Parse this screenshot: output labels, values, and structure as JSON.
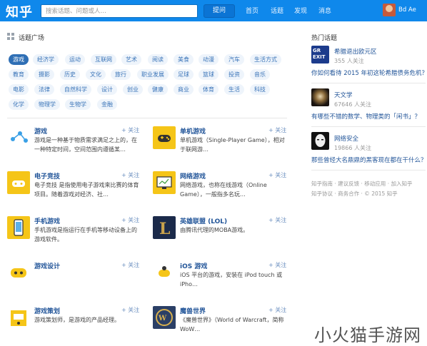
{
  "header": {
    "logo": "知乎",
    "search_placeholder": "搜索话题、问题或人…",
    "ask_label": "提问",
    "nav": [
      "首页",
      "话题",
      "发现",
      "消息"
    ],
    "username": "Bd Ae"
  },
  "topics": {
    "title": "话题广场",
    "tags": [
      [
        "游戏",
        "经济学",
        "运动",
        "互联网",
        "艺术",
        "阅读",
        "美食",
        "动漫",
        "汽车",
        "生活方式"
      ],
      [
        "教育",
        "摄影",
        "历史",
        "文化",
        "旅行",
        "职业发展",
        "足球",
        "篮球",
        "投资",
        "音乐"
      ],
      [
        "电影",
        "法律",
        "自然科学",
        "设计",
        "创业",
        "健康",
        "商业",
        "体育",
        "生活",
        "科技"
      ],
      [
        "化学",
        "物理学",
        "生物学",
        "金融"
      ]
    ],
    "cards": [
      {
        "title": "游戏",
        "desc": "游戏是一种基于物质需求满足之上的，在一种特定时间，空间范围内遵循某…",
        "follow": "+ 关注"
      },
      {
        "title": "单机游戏",
        "desc": "单机游戏（Single-Player Game），相对于联网游…",
        "follow": "+ 关注"
      },
      {
        "title": "电子竞技",
        "desc": "电子竞技 是指使用电子游戏来比赛的体育项目。随着游戏对经济、社…",
        "follow": "+ 关注"
      },
      {
        "title": "网络游戏",
        "desc": "网络游戏，也称在线游戏（Online Game），一般指多名玩…",
        "follow": "+ 关注"
      },
      {
        "title": "手机游戏",
        "desc": "手机游戏是指运行在手机等移动设备上的游戏软件。",
        "follow": "+ 关注"
      },
      {
        "title": "英雄联盟 (LOL)",
        "desc": "由腾讯代理的MOBA游戏。",
        "follow": "+ 关注"
      },
      {
        "title": "游戏设计",
        "desc": "",
        "follow": "+ 关注"
      },
      {
        "title": "iOS 游戏",
        "desc": "iOS 平台的游戏，安装在 iPod touch 或 iPho…",
        "follow": "+ 关注"
      },
      {
        "title": "游戏策划",
        "desc": "游戏策划师，是游戏的产品经理。",
        "follow": "+ 关注"
      },
      {
        "title": "魔兽世界",
        "desc": "《魔兽世界》（World of Warcraft，简称 WoW…",
        "follow": "+ 关注"
      }
    ]
  },
  "hot": {
    "title": "热门话题",
    "items": [
      {
        "badge": "GR EXIT",
        "title": "希腊退出欧元区",
        "count": "355 人关注",
        "question": "你如何看待 2015 年初这轮希腊债务危机？"
      },
      {
        "title": "天文学",
        "count": "67646 人关注",
        "question": "有哪些不错的数学、物理类的「闲书」？"
      },
      {
        "title": "网络安全",
        "count": "19866 人关注",
        "question": "那些曾经大名鼎鼎的黑客现在都在干什么？"
      }
    ]
  },
  "footer": {
    "line1": "知乎指南 · 建议反馈 · 移动应用 · 加入知乎",
    "line2": "知乎协议 · 商务合作 · © 2015 知乎"
  },
  "watermark": "小火猫手游网"
}
